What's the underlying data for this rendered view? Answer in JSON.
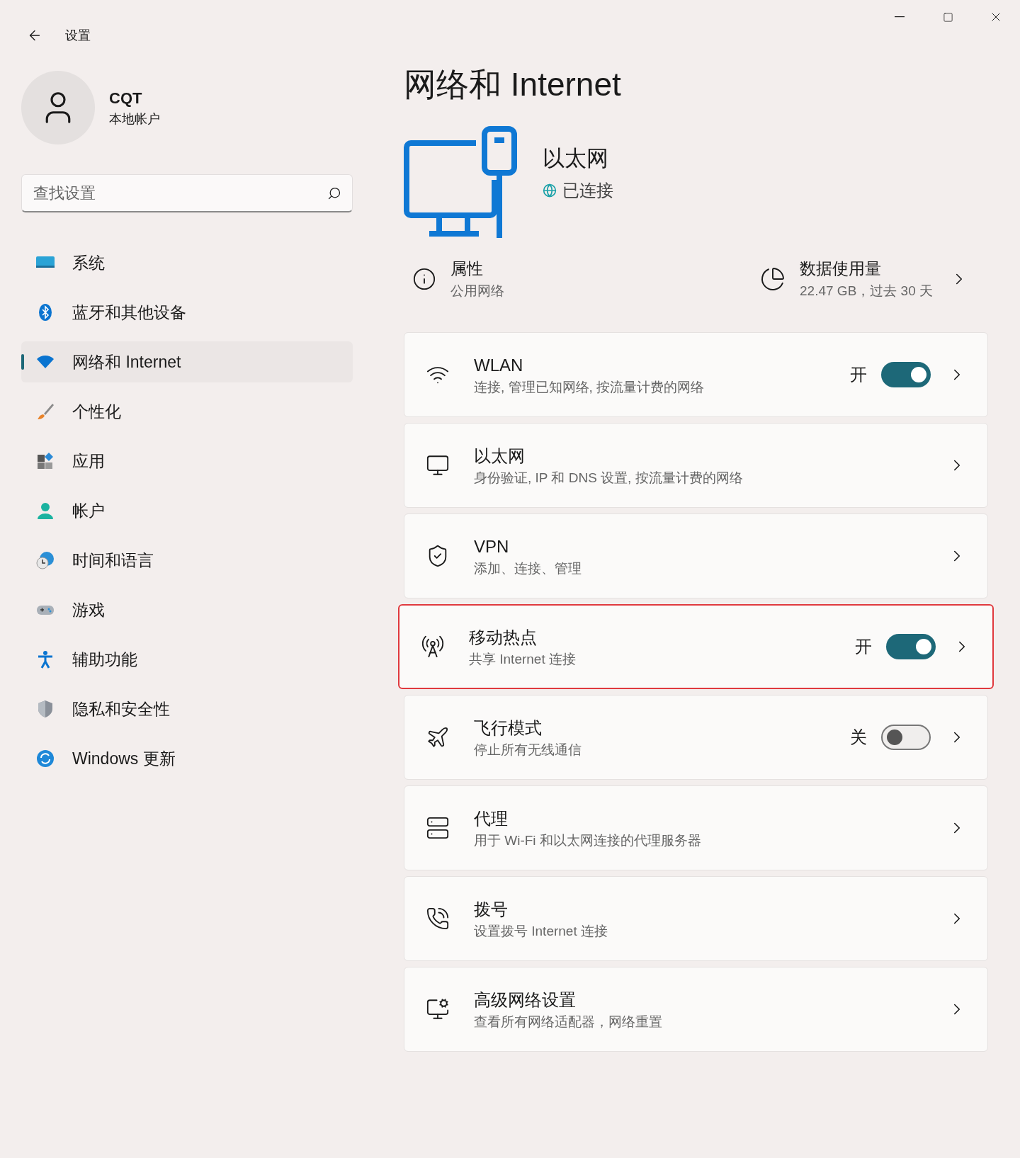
{
  "window": {
    "title": "设置"
  },
  "user": {
    "name": "CQT",
    "account": "本地帐户"
  },
  "search": {
    "placeholder": "查找设置"
  },
  "nav": [
    {
      "label": "系统",
      "selected": false
    },
    {
      "label": "蓝牙和其他设备",
      "selected": false
    },
    {
      "label": "网络和 Internet",
      "selected": true
    },
    {
      "label": "个性化",
      "selected": false
    },
    {
      "label": "应用",
      "selected": false
    },
    {
      "label": "帐户",
      "selected": false
    },
    {
      "label": "时间和语言",
      "selected": false
    },
    {
      "label": "游戏",
      "selected": false
    },
    {
      "label": "辅助功能",
      "selected": false
    },
    {
      "label": "隐私和安全性",
      "selected": false
    },
    {
      "label": "Windows 更新",
      "selected": false
    }
  ],
  "page": {
    "title": "网络和 Internet",
    "connection": {
      "name": "以太网",
      "status": "已连接"
    },
    "properties": {
      "title": "属性",
      "subtitle": "公用网络"
    },
    "data_usage": {
      "title": "数据使用量",
      "subtitle": "22.47 GB，过去 30 天"
    }
  },
  "items": [
    {
      "title": "WLAN",
      "subtitle": "连接, 管理已知网络, 按流量计费的网络",
      "toggle": {
        "label": "开",
        "on": true
      },
      "highlighted": false
    },
    {
      "title": "以太网",
      "subtitle": "身份验证, IP 和 DNS 设置, 按流量计费的网络",
      "highlighted": false
    },
    {
      "title": "VPN",
      "subtitle": "添加、连接、管理",
      "highlighted": false
    },
    {
      "title": "移动热点",
      "subtitle": "共享 Internet 连接",
      "toggle": {
        "label": "开",
        "on": true
      },
      "highlighted": true
    },
    {
      "title": "飞行模式",
      "subtitle": "停止所有无线通信",
      "toggle": {
        "label": "关",
        "on": false
      },
      "highlighted": false
    },
    {
      "title": "代理",
      "subtitle": "用于 Wi-Fi 和以太网连接的代理服务器",
      "highlighted": false
    },
    {
      "title": "拨号",
      "subtitle": "设置拨号 Internet 连接",
      "highlighted": false
    },
    {
      "title": "高级网络设置",
      "subtitle": "查看所有网络适配器，网络重置",
      "highlighted": false
    }
  ]
}
